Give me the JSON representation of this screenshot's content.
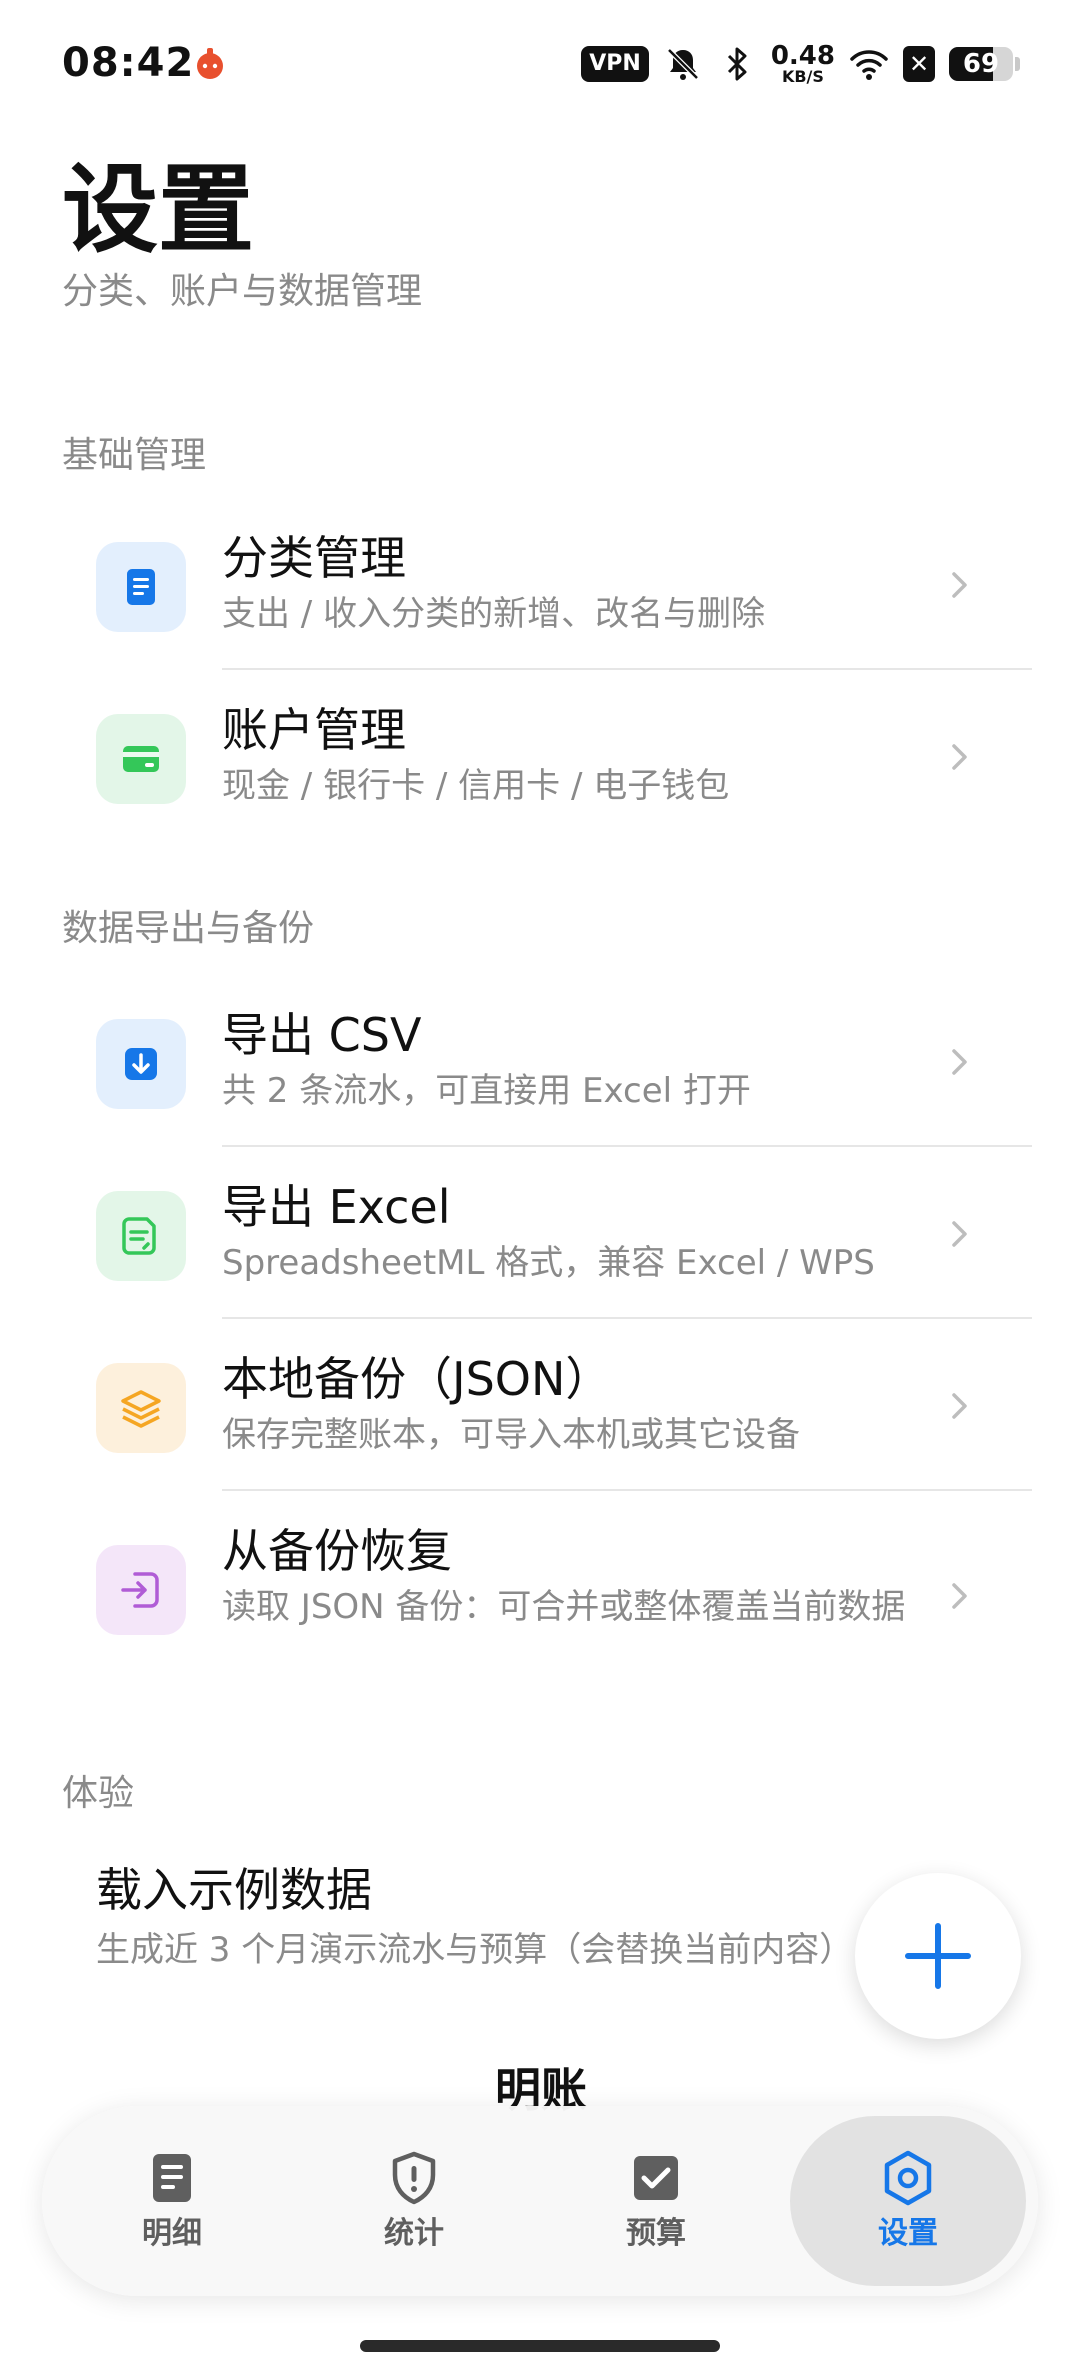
{
  "status_bar": {
    "time": "08:42",
    "vpn_label": "VPN",
    "net_speed_value": "0.48",
    "net_speed_unit": "KB/S",
    "battery_percent": "69",
    "battery_level": 0.69,
    "icons": [
      "app-notification-icon",
      "mute-icon",
      "bluetooth-icon",
      "wifi-icon",
      "sim-off-icon",
      "battery-icon"
    ]
  },
  "header": {
    "title": "设置",
    "subtitle": "分类、账户与数据管理"
  },
  "sections": [
    {
      "label": "基础管理",
      "items": [
        {
          "title": "分类管理",
          "subtitle": "支出 / 收入分类的新增、改名与删除",
          "icon": "document-icon",
          "color": "#1677e8",
          "tile_color": "#e3effd"
        },
        {
          "title": "账户管理",
          "subtitle": "现金 / 银行卡 / 信用卡 / 电子钱包",
          "icon": "card-icon",
          "color": "#34c759",
          "tile_color": "#e3f6e8"
        }
      ]
    },
    {
      "label": "数据导出与备份",
      "items": [
        {
          "title": "导出 CSV",
          "subtitle": "共 2 条流水，可直接用 Excel 打开",
          "icon": "download-icon",
          "color": "#1677e8",
          "tile_color": "#e3effd"
        },
        {
          "title": "导出 Excel",
          "subtitle": "SpreadsheetML 格式，兼容 Excel / WPS",
          "icon": "sheet-icon",
          "color": "#34c759",
          "tile_color": "#e3f6e8"
        },
        {
          "title": "本地备份（JSON）",
          "subtitle": "保存完整账本，可导入本机或其它设备",
          "icon": "layers-icon",
          "color": "#f5a623",
          "tile_color": "#fdf0dc"
        },
        {
          "title": "从备份恢复",
          "subtitle": "读取 JSON 备份：可合并或整体覆盖当前数据",
          "icon": "import-icon",
          "color": "#b05cd6",
          "tile_color": "#f4e6f9"
        }
      ]
    },
    {
      "label": "体验",
      "items": [
        {
          "title": "载入示例数据",
          "subtitle": "生成近 3 个月演示流水与预算（会替换当前内容）"
        }
      ]
    }
  ],
  "peek_text": "明账",
  "fab": {
    "icon": "plus-icon",
    "color": "#1677e8"
  },
  "bottom_nav": [
    {
      "label": "明细",
      "icon": "list-doc-icon",
      "active": false
    },
    {
      "label": "统计",
      "icon": "shield-alert-icon",
      "active": false
    },
    {
      "label": "预算",
      "icon": "checkbox-icon",
      "active": false
    },
    {
      "label": "设置",
      "icon": "settings-hex-icon",
      "active": true
    }
  ],
  "colors": {
    "accent": "#1677e8",
    "text_primary": "#111111",
    "text_secondary": "#8a8a8a",
    "nav_inactive": "#5f5f5f"
  }
}
